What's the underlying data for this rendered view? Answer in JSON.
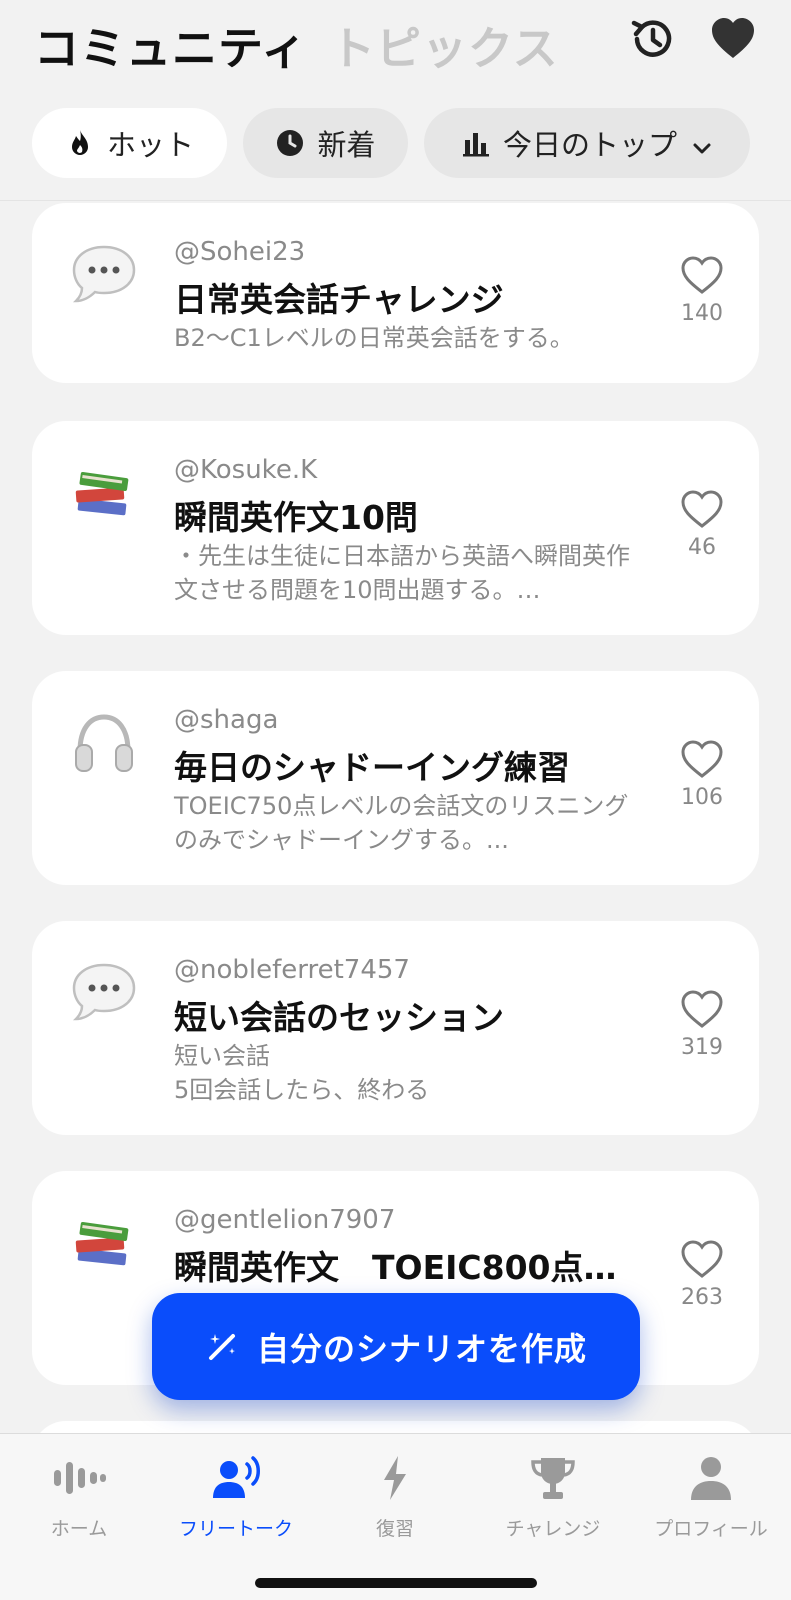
{
  "header": {
    "tab_active": "コミュニティ",
    "tab_inactive": "トピックス",
    "history_icon": "history-icon",
    "favorite_icon": "heart-filled-icon"
  },
  "filters": [
    {
      "label": "ホット",
      "icon": "flame-icon",
      "selected": true
    },
    {
      "label": "新着",
      "icon": "clock-icon",
      "selected": false
    },
    {
      "label": "今日のトップ",
      "icon": "bar-chart-icon",
      "selected": false
    }
  ],
  "cards": [
    {
      "emoji": "speech-bubble-icon",
      "user": "@Sohei23",
      "title": "日常英会話チャレンジ",
      "desc": "B2～C1レベルの日常英会話をする。",
      "likes": "140"
    },
    {
      "emoji": "books-icon",
      "user": "@Kosuke.K",
      "title": "瞬間英作文10問",
      "desc": "・先生は生徒に日本語から英語へ瞬間英作文させる問題を10問出題する。…",
      "likes": "46"
    },
    {
      "emoji": "headphones-icon",
      "user": "@shaga",
      "title": "毎日のシャドーイング練習",
      "desc": "TOEIC750点レベルの会話文のリスニングのみでシャドーイングする。...",
      "likes": "106"
    },
    {
      "emoji": "speech-bubble-icon",
      "user": "@nobleferret7457",
      "title": "短い会話のセッション",
      "desc": "短い会話\n5回会話したら、終わる",
      "likes": "319"
    },
    {
      "emoji": "books-icon",
      "user": "@gentlelion7907",
      "title": "瞬間英作文　TOEIC800点…",
      "desc": "",
      "likes": "263"
    }
  ],
  "fab": {
    "label": "自分のシナリオを作成",
    "icon": "magic-wand-icon"
  },
  "tabbar": [
    {
      "label": "ホーム",
      "icon": "waveform-icon",
      "active": false
    },
    {
      "label": "フリートーク",
      "icon": "person-speaking-icon",
      "active": true
    },
    {
      "label": "復習",
      "icon": "lightning-icon",
      "active": false
    },
    {
      "label": "チャレンジ",
      "icon": "trophy-icon",
      "active": false
    },
    {
      "label": "プロフィール",
      "icon": "person-icon",
      "active": false
    }
  ],
  "colors": {
    "accent": "#0a4dfb",
    "muted": "#8a8a8a",
    "background": "#f2f2f2"
  }
}
